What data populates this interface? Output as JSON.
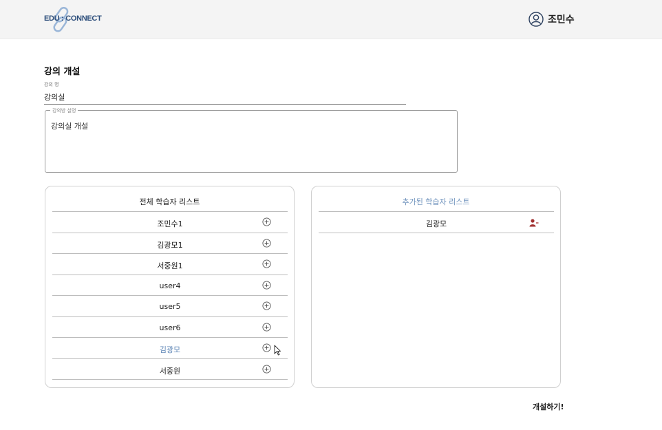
{
  "header": {
    "logo_text": "EDU : CONNECT",
    "username": "조민수"
  },
  "form": {
    "page_title": "강의 개설",
    "name_label": "강의 명",
    "name_value": "강의실",
    "desc_label": "강의방 설명",
    "desc_value": "강의실 개설"
  },
  "all_students": {
    "title": "전체 학습자 리스트",
    "items": [
      {
        "name": "조민수1"
      },
      {
        "name": "김광모1"
      },
      {
        "name": "서중원1"
      },
      {
        "name": "user4"
      },
      {
        "name": "user5"
      },
      {
        "name": "user6"
      },
      {
        "name": "김광모"
      },
      {
        "name": "서중원"
      }
    ]
  },
  "added_students": {
    "title": "추가된 학습자 리스트",
    "items": [
      {
        "name": "김광모"
      }
    ]
  },
  "actions": {
    "submit_label": "개설하기!"
  },
  "colors": {
    "accent": "#6f93bd",
    "highlight_text": "#5e86b6",
    "remove_icon": "#a13030",
    "logo": "#2e4f7c"
  },
  "icons": {
    "add": "plus-circle-icon",
    "remove": "person-remove-icon",
    "user": "user-circle-icon"
  }
}
